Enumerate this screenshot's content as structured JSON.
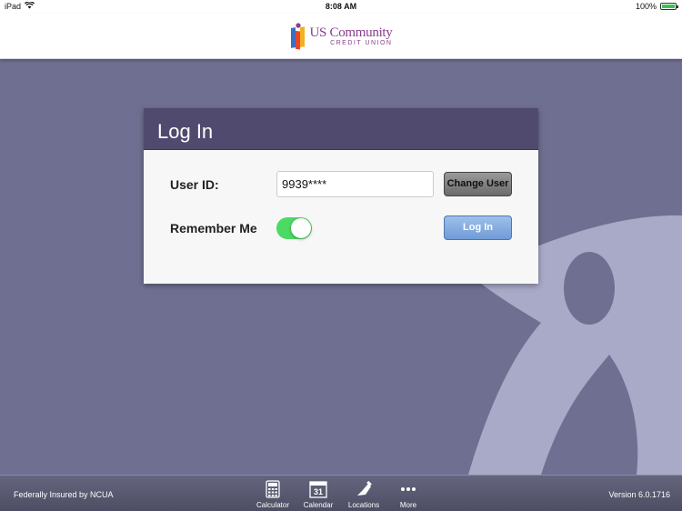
{
  "status_bar": {
    "device": "iPad",
    "time": "8:08 AM",
    "battery": "100%"
  },
  "header": {
    "logo_line1": "US Community",
    "logo_line2": "CREDIT UNION"
  },
  "login": {
    "title": "Log In",
    "user_id_label": "User ID:",
    "user_id_value": "9939****",
    "change_user_label": "Change User",
    "remember_me_label": "Remember Me",
    "remember_me_on": true,
    "login_button_label": "Log In"
  },
  "footer": {
    "ncua": "Federally Insured by NCUA",
    "version": "Version 6.0.1716",
    "tabs": [
      {
        "label": "Calculator",
        "icon": "calculator-icon"
      },
      {
        "label": "Calendar",
        "icon": "calendar-icon",
        "icon_text": "31"
      },
      {
        "label": "Locations",
        "icon": "locations-icon"
      },
      {
        "label": "More",
        "icon": "more-icon"
      }
    ]
  },
  "colors": {
    "background": "#6f6f91",
    "card_header": "#514a6f",
    "toggle_on": "#4cd964",
    "brand": "#8a3c8e"
  }
}
